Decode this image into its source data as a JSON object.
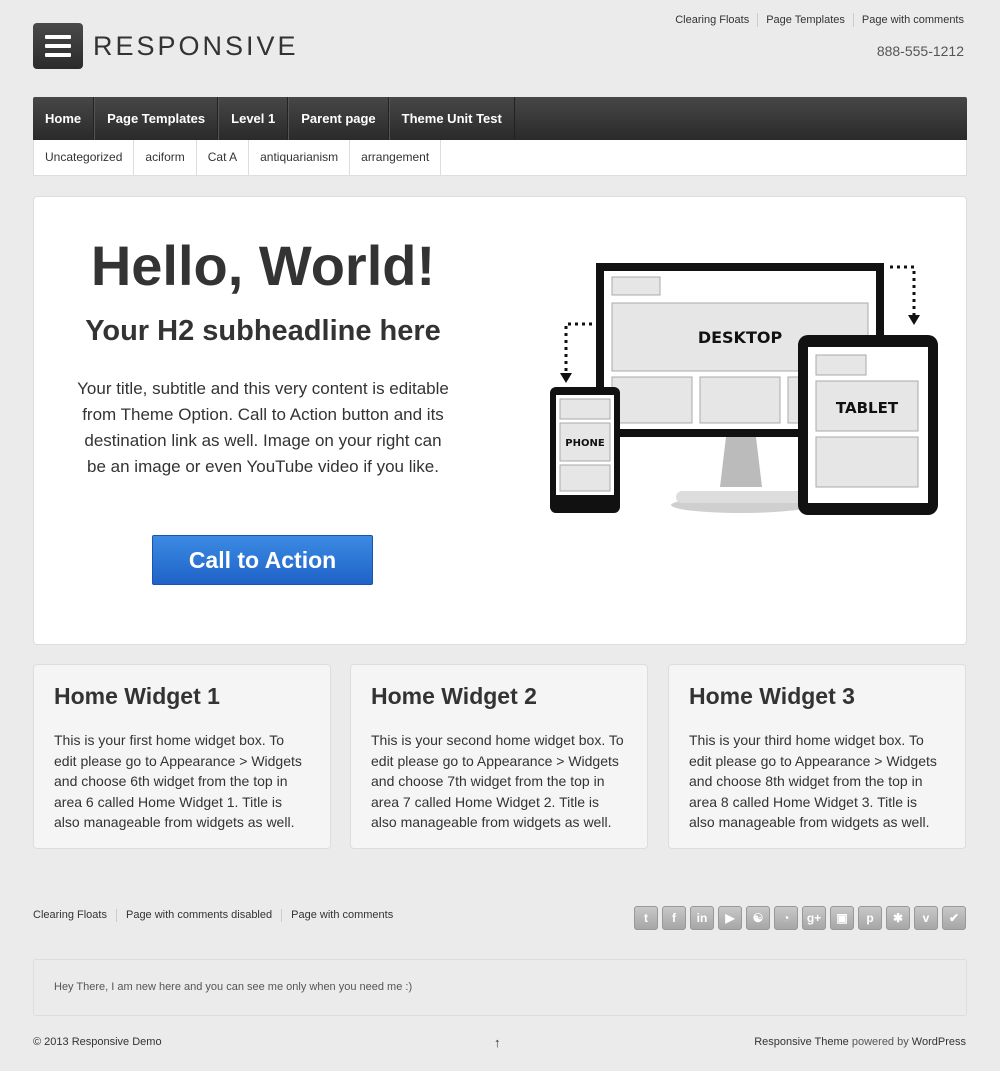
{
  "header": {
    "logo_text": "RESPONSIVE",
    "top_links": [
      "Clearing Floats",
      "Page Templates",
      "Page with comments"
    ],
    "phone": "888-555-1212"
  },
  "main_nav": [
    "Home",
    "Page Templates",
    "Level 1",
    "Parent page",
    "Theme Unit Test"
  ],
  "sub_nav": [
    "Uncategorized",
    "aciform",
    "Cat A",
    "antiquarianism",
    "arrangement"
  ],
  "featured": {
    "title": "Hello, World!",
    "subtitle": "Your H2 subheadline here",
    "body": "Your title, subtitle and this very content is editable from Theme Option. Call to Action button and its destination link as well. Image on your right can be an image or even YouTube video if you like.",
    "cta_label": "Call to Action",
    "image_labels": {
      "desktop": "DESKTOP",
      "tablet": "TABLET",
      "phone": "PHONE"
    }
  },
  "widgets": [
    {
      "title": "Home Widget 1",
      "body": "This is your first home widget box. To edit please go to Appearance > Widgets and choose 6th widget from the top in area 6 called Home Widget 1. Title is also manageable from widgets as well."
    },
    {
      "title": "Home Widget 2",
      "body": "This is your second home widget box. To edit please go to Appearance > Widgets and choose 7th widget from the top in area 7 called Home Widget 2. Title is also manageable from widgets as well."
    },
    {
      "title": "Home Widget 3",
      "body": "This is your third home widget box. To edit please go to Appearance > Widgets and choose 8th widget from the top in area 8 called Home Widget 3. Title is also manageable from widgets as well."
    }
  ],
  "footer": {
    "links": [
      "Clearing Floats",
      "Page with comments disabled",
      "Page with comments"
    ],
    "social_icons": [
      "twitter-icon",
      "facebook-icon",
      "linkedin-icon",
      "youtube-icon",
      "stumbleupon-icon",
      "rss-icon",
      "googleplus-icon",
      "instagram-icon",
      "pinterest-icon",
      "yelp-icon",
      "vimeo-icon",
      "foursquare-icon"
    ],
    "notice": "Hey There, I am new here and you can see me only when you need me :)",
    "copyright": "© 2013 Responsive Demo",
    "scroll_top": "↑",
    "powered_theme": "Responsive Theme",
    "powered_by": "powered by",
    "powered_wp": "WordPress"
  }
}
